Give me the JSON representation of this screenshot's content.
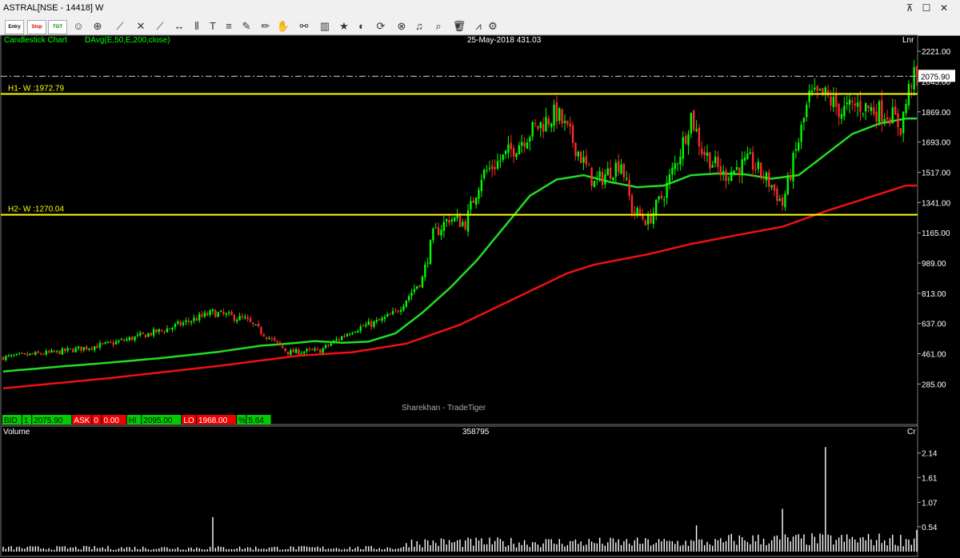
{
  "window": {
    "title": "ASTRAL[NSE - 14418] W"
  },
  "toolbar": {
    "entry_label": "Entry",
    "stop_label": "Stop",
    "tgt_label": "TGT"
  },
  "chart_header": {
    "type_label": "Candlestick Chart",
    "indicator_label": "DAvg(E,50,E,200,close)",
    "cursor_info": "25-May-2018 431.03",
    "scale_label": "Lnr",
    "watermark": "Sharekhan - TradeTiger"
  },
  "quote_bar": {
    "bid_label": "BID",
    "bid_qty": "1",
    "bid": "2075.90",
    "ask_label": "ASK",
    "ask_qty": "0",
    "ask": "0.00",
    "hi_label": "HI",
    "hi": "2095.00",
    "lo_label": "LO",
    "lo": "1968.00",
    "pct_label": "%",
    "pct": "5.64"
  },
  "volume_header": {
    "label": "Volume",
    "value": "358795",
    "unit": "Cr"
  },
  "colors": {
    "up": "#00ff00",
    "down": "#ff2a2a",
    "ema50": "#22dd22",
    "ema200": "#ee1111",
    "hline": "#ffff00",
    "volume": "#ffffff",
    "last_price_bg": "#ffffff"
  },
  "chart_data": [
    {
      "type": "candlestick",
      "title": "ASTRAL[NSE - 14418] W",
      "scale": "linear",
      "ylim": [
        110,
        2310
      ],
      "y_ticks": [
        "2221.00",
        "2045.00",
        "1869.00",
        "1693.00",
        "1517.00",
        "1341.00",
        "1165.00",
        "989.00",
        "813.00",
        "637.00",
        "461.00",
        "285.00"
      ],
      "last_price": "2075.90",
      "horizontal_lines": [
        {
          "label": "H1- W :1972.79",
          "value": 1972.79
        },
        {
          "label": "H2- W :1270.04",
          "value": 1270.04
        }
      ],
      "moving_averages": [
        {
          "name": "EMA 50",
          "color": "#22dd22",
          "points": [
            [
              0,
              358
            ],
            [
              20,
              385
            ],
            [
              40,
              410
            ],
            [
              60,
              438
            ],
            [
              80,
              472
            ],
            [
              96,
              508
            ],
            [
              106,
              520
            ],
            [
              116,
              535
            ],
            [
              126,
              525
            ],
            [
              136,
              532
            ],
            [
              146,
              580
            ],
            [
              156,
              700
            ],
            [
              166,
              840
            ],
            [
              176,
              1000
            ],
            [
              186,
              1190
            ],
            [
              196,
              1380
            ],
            [
              206,
              1475
            ],
            [
              216,
              1500
            ],
            [
              226,
              1460
            ],
            [
              236,
              1430
            ],
            [
              246,
              1440
            ],
            [
              256,
              1500
            ],
            [
              266,
              1510
            ],
            [
              276,
              1505
            ],
            [
              286,
              1480
            ],
            [
              296,
              1500
            ],
            [
              306,
              1620
            ],
            [
              316,
              1740
            ],
            [
              326,
              1800
            ],
            [
              336,
              1830
            ]
          ]
        },
        {
          "name": "EMA 200",
          "color": "#ee1111",
          "points": [
            [
              0,
              260
            ],
            [
              40,
              320
            ],
            [
              80,
              390
            ],
            [
              110,
              450
            ],
            [
              130,
              470
            ],
            [
              150,
              520
            ],
            [
              170,
              630
            ],
            [
              190,
              780
            ],
            [
              210,
              930
            ],
            [
              220,
              980
            ],
            [
              240,
              1040
            ],
            [
              256,
              1100
            ],
            [
              276,
              1160
            ],
            [
              290,
              1200
            ],
            [
              306,
              1290
            ],
            [
              316,
              1340
            ],
            [
              336,
              1440
            ]
          ]
        }
      ],
      "ohlc_anchors": [
        [
          0,
          440
        ],
        [
          20,
          470
        ],
        [
          40,
          520
        ],
        [
          60,
          600
        ],
        [
          78,
          700
        ],
        [
          90,
          660
        ],
        [
          106,
          470
        ],
        [
          118,
          480
        ],
        [
          130,
          600
        ],
        [
          140,
          650
        ],
        [
          146,
          700
        ],
        [
          156,
          900
        ],
        [
          160,
          1150
        ],
        [
          166,
          1250
        ],
        [
          172,
          1220
        ],
        [
          178,
          1500
        ],
        [
          186,
          1600
        ],
        [
          196,
          1750
        ],
        [
          206,
          1860
        ],
        [
          212,
          1700
        ],
        [
          220,
          1450
        ],
        [
          230,
          1580
        ],
        [
          234,
          1300
        ],
        [
          240,
          1230
        ],
        [
          246,
          1400
        ],
        [
          252,
          1640
        ],
        [
          256,
          1850
        ],
        [
          260,
          1650
        ],
        [
          268,
          1500
        ],
        [
          278,
          1580
        ],
        [
          286,
          1440
        ],
        [
          290,
          1330
        ],
        [
          296,
          1700
        ],
        [
          300,
          1950
        ],
        [
          306,
          1960
        ],
        [
          312,
          1870
        ],
        [
          318,
          1910
        ],
        [
          324,
          1880
        ],
        [
          330,
          1860
        ],
        [
          334,
          1780
        ],
        [
          338,
          2060
        ]
      ]
    },
    {
      "type": "bar",
      "title": "Volume",
      "unit": "Cr",
      "ylim": [
        0,
        2.5
      ],
      "y_ticks": [
        "2.14",
        "1.61",
        "1.07",
        "0.54"
      ],
      "peaks": [
        [
          78,
          0.75
        ],
        [
          290,
          0.93
        ],
        [
          306,
          2.27
        ],
        [
          258,
          0.57
        ],
        [
          340,
          0.47
        ]
      ]
    }
  ]
}
